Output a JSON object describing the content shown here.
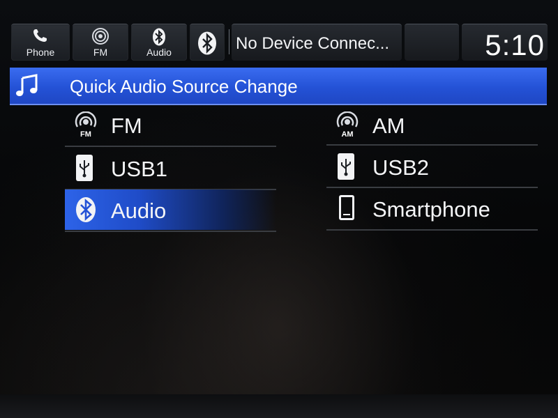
{
  "topbar": {
    "phone_label": "Phone",
    "fm_label": "FM",
    "audio_label": "Audio",
    "device_status": "No Device Connec...",
    "clock": "5:10"
  },
  "header": {
    "title": "Quick Audio Source Change"
  },
  "sources": [
    {
      "label": "FM",
      "icon": "fm-radio-icon",
      "active": false
    },
    {
      "label": "AM",
      "icon": "am-radio-icon",
      "active": false
    },
    {
      "label": "USB1",
      "icon": "usb-icon",
      "active": false
    },
    {
      "label": "USB2",
      "icon": "usb-icon",
      "active": false
    },
    {
      "label": "Audio",
      "icon": "bluetooth-icon",
      "active": true
    },
    {
      "label": "Smartphone",
      "icon": "smartphone-icon",
      "active": false
    }
  ],
  "radio_icon_text": {
    "fm": "FM",
    "am": "AM"
  },
  "colors": {
    "header_blue": "#2a5ae0",
    "active_blue": "#2d63e8",
    "background": "#050608"
  }
}
